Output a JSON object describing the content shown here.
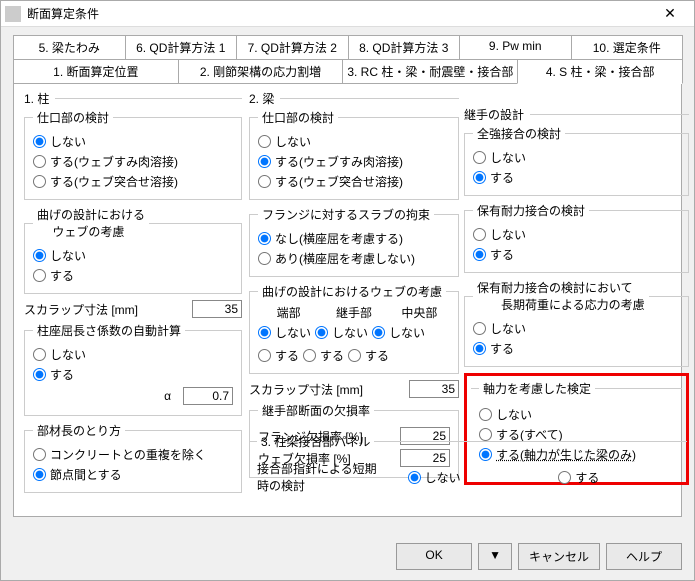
{
  "window": {
    "title": "断面算定条件"
  },
  "tabs_row1": [
    "5. 梁たわみ",
    "6. QD計算方法 1",
    "7. QD計算方法 2",
    "8. QD計算方法 3",
    "9. Pw min",
    "10. 選定条件"
  ],
  "tabs_row2": [
    "1. 断面算定位置",
    "2. 剛節架構の応力割増",
    "3. RC 柱・梁・耐震壁・接合部",
    "4. S 柱・梁・接合部"
  ],
  "col1": {
    "title": "1. 柱",
    "shiguchi": {
      "title": "仕口部の検討",
      "o1": "しない",
      "o2": "する(ウェブすみ肉溶接)",
      "o3": "する(ウェブ突合せ溶接)"
    },
    "mage": {
      "title": "曲げの設計における\n　 ウェブの考慮",
      "o1": "しない",
      "o2": "する"
    },
    "scallop": {
      "label": "スカラップ寸法 [mm]",
      "value": "35"
    },
    "buckle": {
      "title": "柱座屈長さ係数の自動計算",
      "o1": "しない",
      "o2": "する",
      "alpha_label": "α",
      "alpha": "0.7"
    },
    "member": {
      "title": "部材長のとり方",
      "o1": "コンクリートとの重複を除く",
      "o2": "節点間とする"
    }
  },
  "col2": {
    "title": "2. 梁",
    "shiguchi": {
      "title": "仕口部の検討",
      "o1": "しない",
      "o2": "する(ウェブすみ肉溶接)",
      "o3": "する(ウェブ突合せ溶接)"
    },
    "flange": {
      "title": "フランジに対するスラブの拘束",
      "o1": "なし(横座屈を考慮する)",
      "o2": "あり(横座屈を考慮しない)"
    },
    "mage": {
      "title": "曲げの設計におけるウェブの考慮",
      "h1": "端部",
      "h2": "継手部",
      "h3": "中央部",
      "o1": "しない",
      "o2": "する"
    },
    "scallop": {
      "label": "スカラップ寸法 [mm]",
      "value": "35"
    },
    "loss": {
      "title": "継手部断面の欠損率",
      "l1": "フランジ欠損率 [%]",
      "v1": "25",
      "l2": "ウェブ欠損率 [%]",
      "v2": "25"
    }
  },
  "col3": {
    "joint": {
      "title": "継手の設計"
    },
    "full": {
      "title": "全強接合の検討",
      "o1": "しない",
      "o2": "する"
    },
    "hoyu": {
      "title": "保有耐力接合の検討",
      "o1": "しない",
      "o2": "する"
    },
    "long": {
      "title": "保有耐力接合の検討において\n　　長期荷重による応力の考慮",
      "o1": "しない",
      "o2": "する"
    },
    "axial": {
      "title": "軸力を考慮した検定",
      "o1": "しない",
      "o2": "する(すべて)",
      "o3": "する(軸力が生じた梁のみ)"
    }
  },
  "panel3": {
    "title": "3. 柱梁接合部パネル",
    "label": "接合部指針による短期時の検討",
    "o1": "しない",
    "o2": "する"
  },
  "footer": {
    "ok": "OK",
    "dd": "▼",
    "cancel": "キャンセル",
    "help": "ヘルプ"
  }
}
